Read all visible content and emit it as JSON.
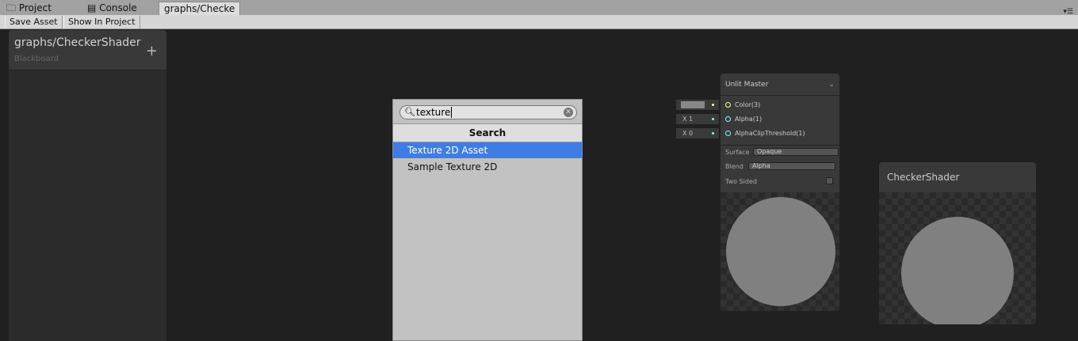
{
  "tabs": [
    {
      "label": "Project",
      "icon": "folder-icon"
    },
    {
      "label": "Console",
      "icon": "console-icon"
    },
    {
      "label": "graphs/Checke",
      "active": true
    }
  ],
  "toolbar": {
    "save_label": "Save Asset",
    "show_label": "Show In Project"
  },
  "blackboard": {
    "title": "graphs/CheckerShader",
    "subtitle": "Blackboard",
    "add": "+"
  },
  "search": {
    "value": "texture",
    "header": "Search",
    "items": [
      {
        "label": "Texture 2D Asset",
        "selected": true
      },
      {
        "label": "Sample Texture 2D"
      }
    ]
  },
  "master": {
    "title": "Unlit Master",
    "ports": [
      "Color(3)",
      "Alpha(1)",
      "AlphaClipThreshold(1)"
    ],
    "inputs": [
      "X 1",
      "X 0"
    ],
    "surface_label": "Surface",
    "surface_value": "Opaque",
    "blend_label": "Blend",
    "blend_value": "Alpha",
    "two_sided_label": "Two Sided"
  },
  "preview": {
    "title": "CheckerShader"
  },
  "colors": {
    "selection": "#3d7de5",
    "port_color": "#ffff88",
    "port_float": "#77ffff"
  }
}
